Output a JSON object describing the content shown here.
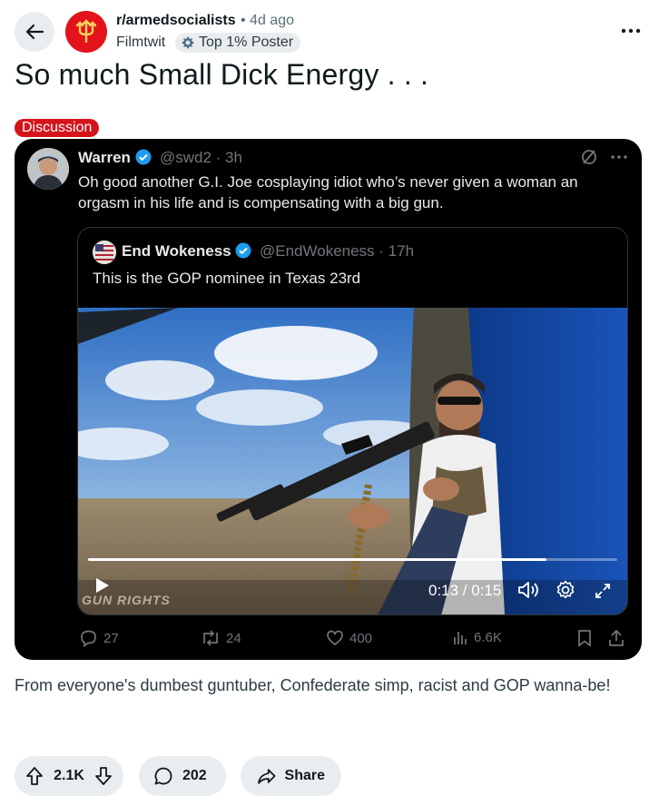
{
  "header": {
    "subreddit": "r/armedsocialists",
    "meta": "• 4d ago",
    "username": "Filmtwit",
    "flair": "Top 1% Poster"
  },
  "post": {
    "title": "So much Small Dick Energy . . .",
    "tag": "Discussion",
    "body": "From everyone's dumbest guntuber, Confederate simp, racist and GOP wanna-be!"
  },
  "tweet": {
    "name": "Warren",
    "handle": "@swd2 · 3h",
    "text": "Oh good another G.I. Joe cosplaying idiot who’s never given a woman an orgasm in his life and is compensating with a big gun.",
    "quote": {
      "name": "End Wokeness",
      "handle": "@EndWokeness · 17h",
      "text": "This is the GOP nominee in Texas 23rd"
    },
    "video": {
      "time": "0:13 / 0:15",
      "watermark": "GUN RIGHTS",
      "progress": 0.867
    },
    "stats": {
      "replies": "27",
      "retweets": "24",
      "likes": "400",
      "views": "6.6K"
    }
  },
  "footer": {
    "votes": "2.1K",
    "comments": "202",
    "share": "Share"
  },
  "colors": {
    "subreddit_red": "#e4121b",
    "tag_red": "#d4141b",
    "verified_blue": "#1d9bf0",
    "pill_bg": "#eaedef"
  }
}
